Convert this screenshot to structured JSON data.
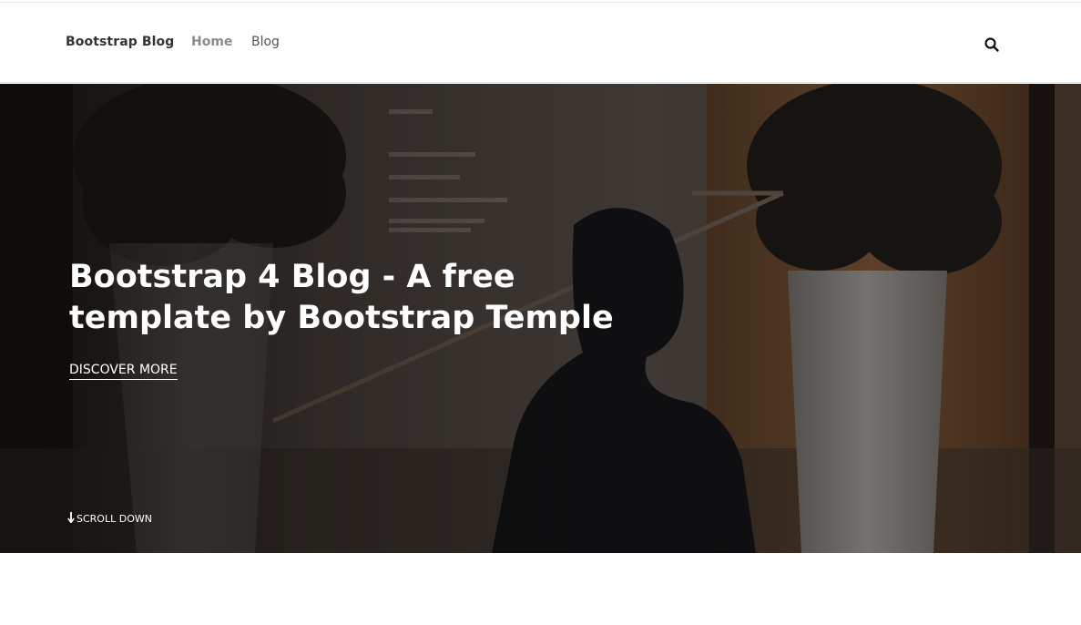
{
  "navbar": {
    "brand": "Bootstrap Blog",
    "links": [
      {
        "label": "Home",
        "active": true
      },
      {
        "label": "Blog",
        "active": false
      }
    ],
    "search_icon": "search-icon"
  },
  "hero": {
    "title": "Bootstrap 4 Blog - A free template by Bootstrap Temple",
    "cta_label": "DISCOVER MORE",
    "scroll_label": "SCROLL DOWN",
    "scroll_icon": "arrow-down-icon"
  },
  "colors": {
    "active_link": "#8a8a8a",
    "link": "#555555",
    "brand": "#333333",
    "hero_text": "#ffffff"
  }
}
